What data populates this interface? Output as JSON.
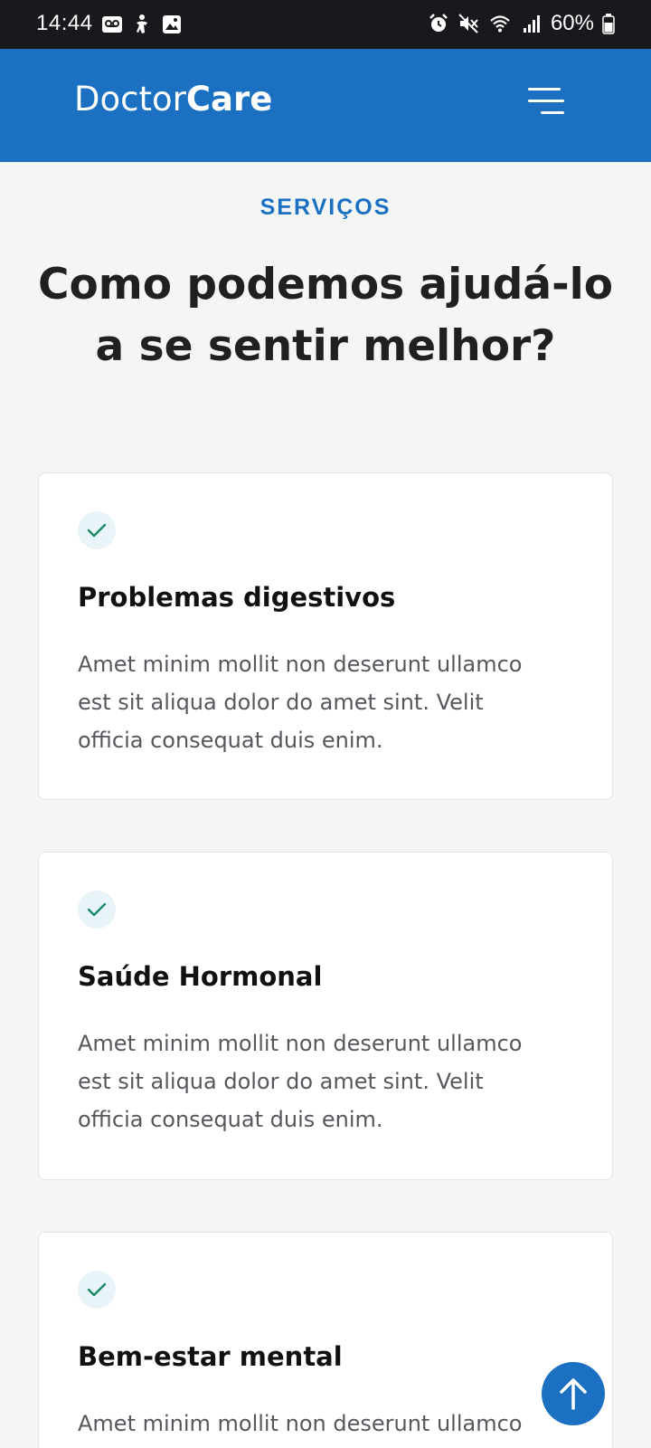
{
  "status_bar": {
    "time": "14:44",
    "battery_percent": "60%",
    "left_icons": [
      "voicemail-icon",
      "accessibility-icon",
      "gallery-icon"
    ],
    "right_icons": [
      "alarm-icon",
      "mute-icon",
      "wifi-icon",
      "signal-icon",
      "battery-icon"
    ]
  },
  "header": {
    "logo_light": "Doctor",
    "logo_bold": "Care",
    "background": "#1b70c1"
  },
  "section": {
    "tag": "SERVIÇOS",
    "title_line1": "Como podemos ajudá-lo",
    "title_line2": "a se sentir melhor?"
  },
  "services": [
    {
      "title": "Problemas digestivos",
      "line1": "Amet minim mollit non deserunt ullamco",
      "line2": "est sit aliqua dolor do amet sint. Velit",
      "line3": "officia consequat duis enim."
    },
    {
      "title": "Saúde Hormonal",
      "line1": "Amet minim mollit non deserunt ullamco",
      "line2": "est sit aliqua dolor do amet sint. Velit",
      "line3": "officia consequat duis enim."
    },
    {
      "title": "Bem-estar mental",
      "line1": "Amet minim mollit non deserunt ullamco",
      "line2": "",
      "line3": ""
    }
  ],
  "colors": {
    "primary": "#1b70c1",
    "check": "#1a8a6a",
    "page_background": "#f4f6f6"
  }
}
